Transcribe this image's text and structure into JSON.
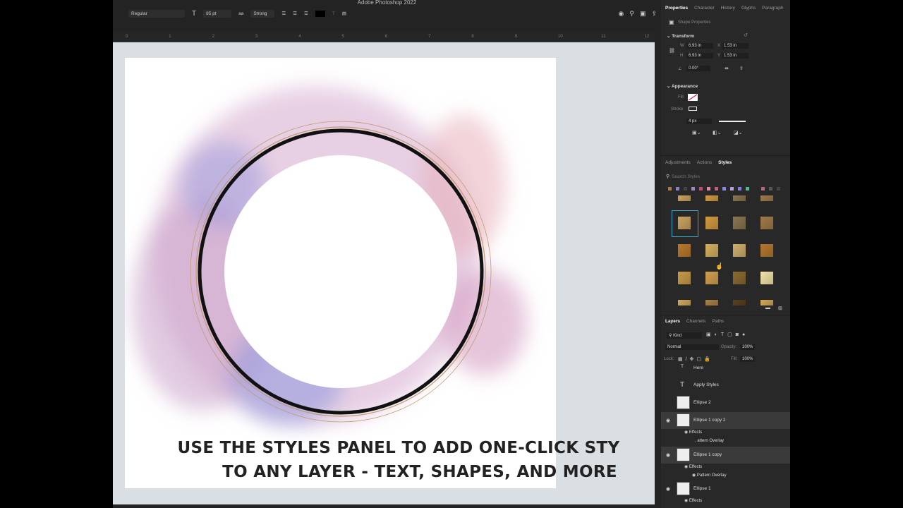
{
  "app": {
    "title": "Adobe Photoshop 2022"
  },
  "options": {
    "font_style": "Regular",
    "font_size": "85 pt",
    "antialias": "Strong"
  },
  "ruler": [
    "0",
    "1",
    "2",
    "3",
    "4",
    "5",
    "6",
    "7",
    "8",
    "9",
    "10",
    "11",
    "12"
  ],
  "caption": {
    "line1": "USE THE STYLES PANEL TO ADD ONE-CLICK STY",
    "line2": "TO ANY LAYER - TEXT, SHAPES, AND MORE"
  },
  "properties": {
    "tabs": [
      "Properties",
      "Character",
      "History",
      "Glyphs",
      "Paragraph"
    ],
    "kind": "Shape Properties",
    "transform": "Transform",
    "w_label": "W",
    "w": "6.93 in",
    "h_label": "H",
    "h": "6.93 in",
    "x_label": "X",
    "x": "1.53 in",
    "y_label": "Y",
    "y": "1.53 in",
    "angle": "0.00°",
    "appearance": "Appearance",
    "fill": "Fill",
    "stroke": "Stroke",
    "stroke_width": "4 px"
  },
  "styles": {
    "tabs": [
      "Adjustments",
      "Actions",
      "Styles"
    ],
    "search_placeholder": "Search Styles",
    "chips": [
      "#b07a3a",
      "#8c7fc0",
      "#444",
      "#9a8ab8",
      "#d04070",
      "#e088a0",
      "#d05878",
      "#8a8ae0",
      "#b0a0e0",
      "#8080d8",
      "#40c0a0",
      "#c06080",
      "#555",
      "#444"
    ],
    "rows": [
      [
        "#c9a260",
        "#d09a40",
        "#8a7450",
        "#a07a48"
      ],
      [
        "#b8782c",
        "#d4b060",
        "#cfae6c",
        "#b47830"
      ],
      [
        "#c89a48",
        "#d0a050",
        "#8a6a30",
        "#f4e4a8"
      ],
      [
        "#d0a860",
        "#a88048",
        "#5a4020",
        "#d0a858"
      ]
    ]
  },
  "layers": {
    "tabs": [
      "Layers",
      "Channels",
      "Paths"
    ],
    "filter": "Kind",
    "blend": "Normal",
    "opacity_label": "Opacity:",
    "opacity": "100%",
    "lock_label": "Lock:",
    "fill_label": "Fill:",
    "fill": "100%",
    "items": [
      {
        "name": "Here"
      },
      {
        "name": "Apply Styles"
      },
      {
        "name": "Ellipse 2"
      },
      {
        "name": "Ellipse 1 copy 2"
      },
      {
        "name": "Ellipse 1 copy"
      },
      {
        "name": "Ellipse 1"
      }
    ],
    "effects": "Effects",
    "pattern_cut": "attern Overlay",
    "pattern": "Pattern Overlay"
  }
}
